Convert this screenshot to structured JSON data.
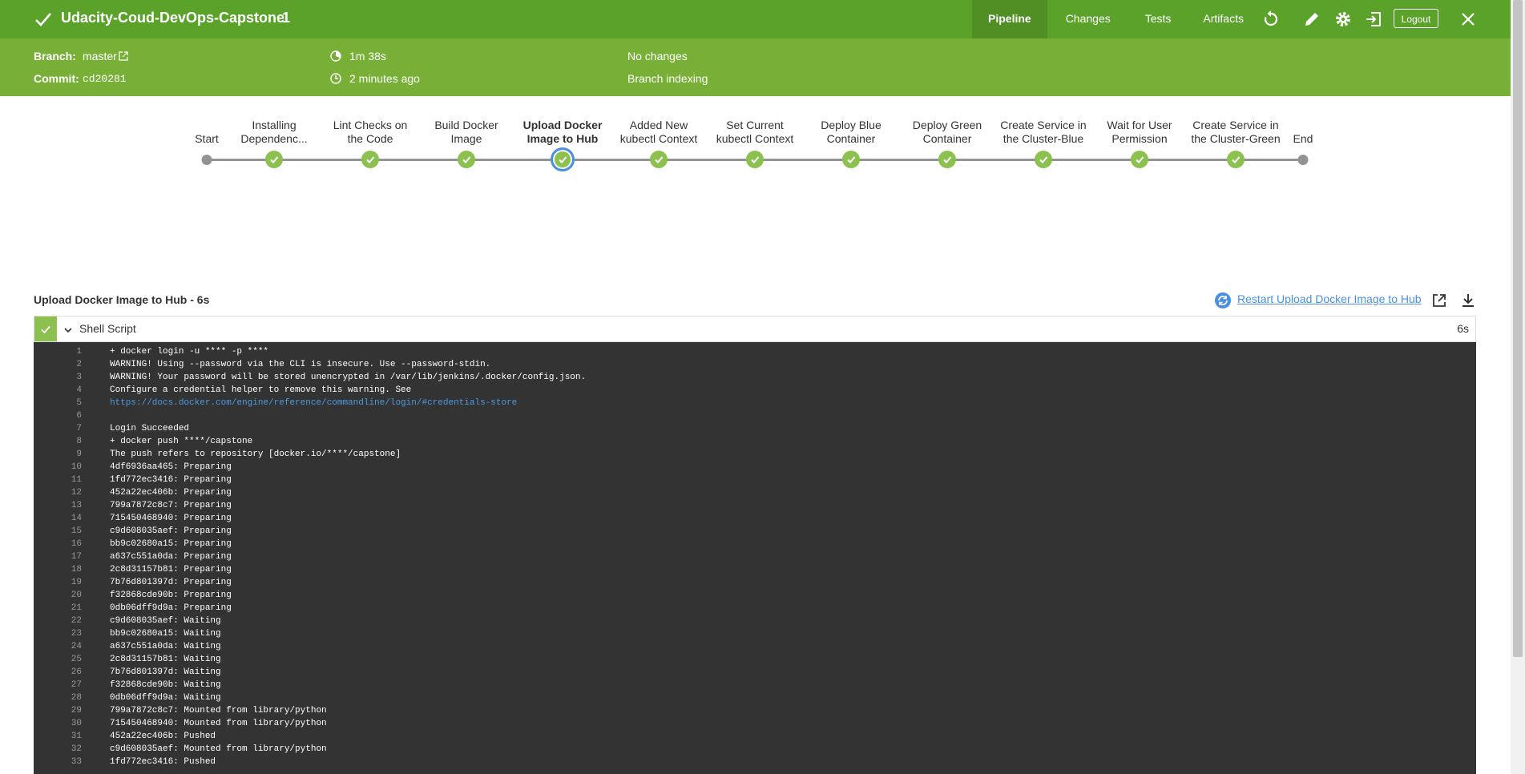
{
  "header": {
    "title": "Udacity-Coud-DevOps-Capstone",
    "run_number": "1",
    "tabs": [
      "Pipeline",
      "Changes",
      "Tests",
      "Artifacts"
    ],
    "logout_label": "Logout",
    "icons": [
      "replay-icon",
      "edit-icon",
      "settings-icon",
      "exit-classic-icon",
      "close-icon"
    ]
  },
  "summary": {
    "branch_label": "Branch:",
    "branch_value": "master",
    "commit_label": "Commit:",
    "commit_value": "cd20281",
    "duration": "1m 38s",
    "time_ago": "2 minutes ago",
    "changes": "No changes",
    "cause": "Branch indexing"
  },
  "pipeline": {
    "stages": [
      {
        "label": "Start",
        "label2": "",
        "state": "start"
      },
      {
        "label": "Installing",
        "label2": "Dependenc...",
        "state": "success"
      },
      {
        "label": "Lint Checks on",
        "label2": "the Code",
        "state": "success"
      },
      {
        "label": "Build Docker",
        "label2": "Image",
        "state": "success"
      },
      {
        "label": "Upload Docker",
        "label2": "Image to Hub",
        "state": "selected"
      },
      {
        "label": "Added New",
        "label2": "kubectl Context",
        "state": "success"
      },
      {
        "label": "Set Current",
        "label2": "kubectl Context",
        "state": "success"
      },
      {
        "label": "Deploy Blue",
        "label2": "Container",
        "state": "success"
      },
      {
        "label": "Deploy Green",
        "label2": "Container",
        "state": "success"
      },
      {
        "label": "Create Service in",
        "label2": "the Cluster-Blue",
        "state": "success"
      },
      {
        "label": "Wait for User",
        "label2": "Permission",
        "state": "success"
      },
      {
        "label": "Create Service in",
        "label2": "the Cluster-Green",
        "state": "success"
      },
      {
        "label": "End",
        "label2": "",
        "state": "end"
      }
    ]
  },
  "detail": {
    "title": "Upload Docker Image to Hub - 6s",
    "restart_label": "Restart Upload Docker Image to Hub",
    "step_name": "Shell Script",
    "step_duration": "6s"
  },
  "log": [
    "+ docker login -u **** -p ****",
    "WARNING! Using --password via the CLI is insecure. Use --password-stdin.",
    "WARNING! Your password will be stored unencrypted in /var/lib/jenkins/.docker/config.json.",
    "Configure a credential helper to remove this warning. See",
    "https://docs.docker.com/engine/reference/commandline/login/#credentials-store",
    "",
    "Login Succeeded",
    "+ docker push ****/capstone",
    "The push refers to repository [docker.io/****/capstone]",
    "4df6936aa465: Preparing",
    "1fd772ec3416: Preparing",
    "452a22ec406b: Preparing",
    "799a7872c8c7: Preparing",
    "715450468940: Preparing",
    "c9d608035aef: Preparing",
    "bb9c02680a15: Preparing",
    "a637c551a0da: Preparing",
    "2c8d31157b81: Preparing",
    "7b76d801397d: Preparing",
    "f32868cde90b: Preparing",
    "0db06dff9d9a: Preparing",
    "c9d608035aef: Waiting",
    "bb9c02680a15: Waiting",
    "a637c551a0da: Waiting",
    "2c8d31157b81: Waiting",
    "7b76d801397d: Waiting",
    "f32868cde90b: Waiting",
    "0db06dff9d9a: Waiting",
    "799a7872c8c7: Mounted from library/python",
    "715450468940: Mounted from library/python",
    "452a22ec406b: Pushed",
    "c9d608035aef: Mounted from library/python",
    "1fd772ec3416: Pushed"
  ],
  "colors": {
    "header_green": "#5ba22b",
    "subheader_green": "#78b037",
    "success_green": "#8cc04f",
    "selected_blue": "#4a90e2",
    "console_bg": "#333333",
    "link_blue": "#4a9be2"
  }
}
